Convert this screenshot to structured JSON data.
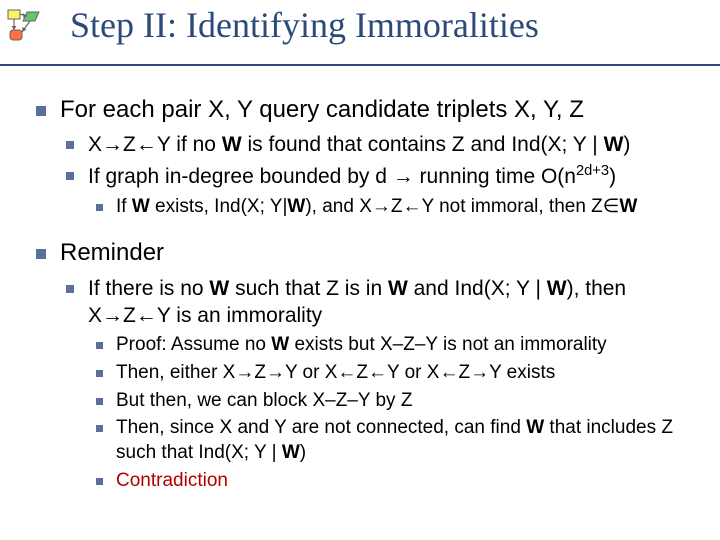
{
  "title": "Step II: Identifying Immoralities",
  "lines": {
    "l1": "For each pair X, Y query candidate triplets X, Y, Z",
    "l2_pre": "X→Z←Y if no ",
    "l2_w": "W",
    "l2_mid": " is found that contains Z and Ind(X; Y | ",
    "l2_w2": "W",
    "l2_post": ")",
    "l3_pre": "If graph in-degree bounded by d → running time O(n",
    "l3_sup": "2d+3",
    "l3_post": ")",
    "l4_pre": "If ",
    "l4_w": "W",
    "l4_mid1": " exists, Ind(X; Y|",
    "l4_w2": "W",
    "l4_mid2": "), and X→Z←Y not immoral, then Z∈",
    "l4_w3": "W",
    "l5": "Reminder",
    "l6_pre": "If there is no ",
    "l6_w": "W",
    "l6_mid1": " such that Z is in ",
    "l6_w2": "W",
    "l6_mid2": " and Ind(X; Y | ",
    "l6_w3": "W",
    "l6_post": "), then X→Z←Y is an immorality",
    "l7_pre": "Proof: Assume no ",
    "l7_w": "W",
    "l7_post": " exists but X–Z–Y is not an immorality",
    "l8": "Then, either X→Z→Y or X←Z←Y or X←Z→Y exists",
    "l9": "But then, we can block X–Z–Y by Z",
    "l10_pre": "Then, since X and Y are not connected, can find ",
    "l10_w": "W",
    "l10_mid": " that includes Z such that Ind(X; Y | ",
    "l10_w2": "W",
    "l10_post": ")",
    "l11": "Contradiction"
  }
}
